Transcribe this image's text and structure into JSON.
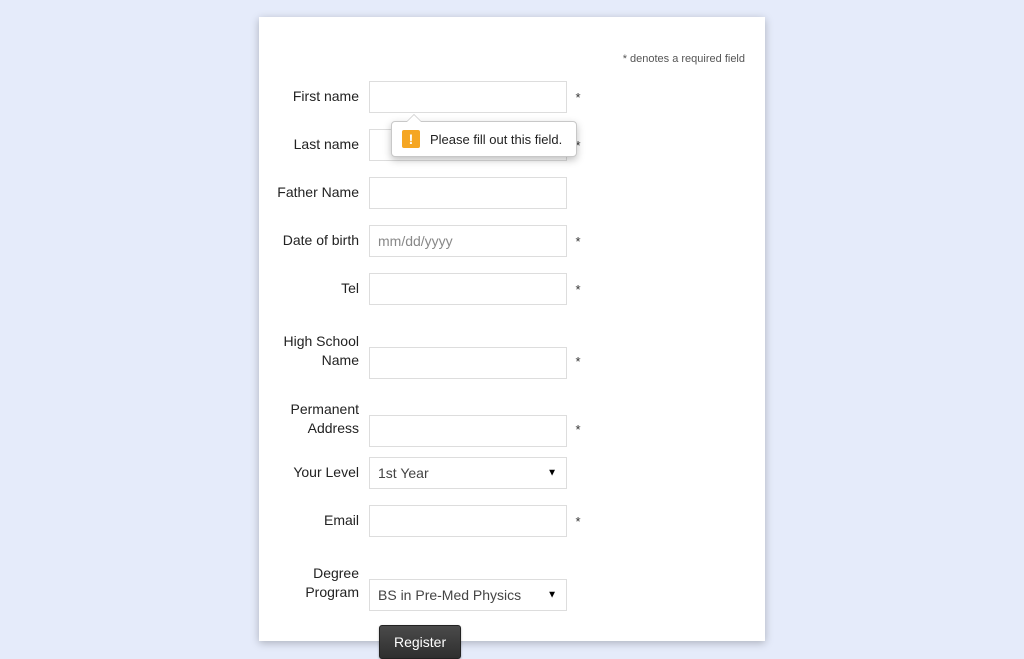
{
  "required_note": "* denotes a required field",
  "tooltip": {
    "text": "Please fill out this field."
  },
  "fields": {
    "first_name": {
      "label": "First name",
      "required": "*"
    },
    "last_name": {
      "label": "Last name",
      "required": "*"
    },
    "father_name": {
      "label": "Father Name",
      "required": ""
    },
    "dob": {
      "label": "Date of birth",
      "placeholder": "mm/dd/yyyy",
      "required": "*"
    },
    "tel": {
      "label": "Tel",
      "required": "*"
    },
    "high_school": {
      "label": "High School Name",
      "required": "*"
    },
    "address": {
      "label": "Permanent Address",
      "required": "*"
    },
    "level": {
      "label": "Your Level",
      "selected": "1st Year",
      "required": ""
    },
    "email": {
      "label": "Email",
      "required": "*"
    },
    "degree": {
      "label": "Degree Program",
      "selected": "BS in Pre-Med Physics",
      "required": ""
    }
  },
  "submit_label": "Register"
}
